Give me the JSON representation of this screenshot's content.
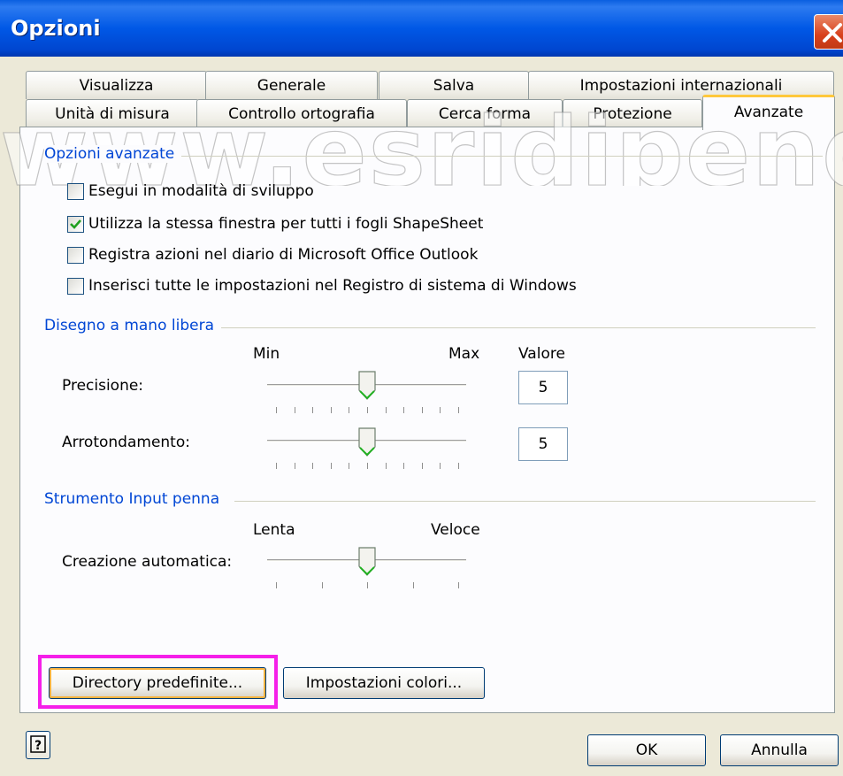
{
  "window": {
    "title": "Opzioni"
  },
  "tabs_row1": [
    "Visualizza",
    "Generale",
    "Salva",
    "Impostazioni internazionali"
  ],
  "tabs_row2": [
    "Unità di misura",
    "Controllo ortografia",
    "Cerca forma",
    "Protezione",
    "Avanzate"
  ],
  "active_tab": "Avanzate",
  "watermark": "www.esridipende",
  "advanced": {
    "title": "Opzioni avanzate",
    "options": [
      {
        "label": "Esegui in modalità di sviluppo",
        "checked": false
      },
      {
        "label": "Utilizza la stessa finestra per tutti i fogli ShapeSheet",
        "checked": true
      },
      {
        "label": "Registra azioni nel diario di Microsoft Office Outlook",
        "checked": false
      },
      {
        "label": "Inserisci tutte le impostazioni nel Registro di sistema di Windows",
        "checked": false
      }
    ]
  },
  "freehand": {
    "title": "Disegno a mano libera",
    "min_label": "Min",
    "max_label": "Max",
    "value_label": "Valore",
    "precision": {
      "label": "Precisione:",
      "value": "5",
      "level": 5,
      "max": 10
    },
    "rounding": {
      "label": "Arrotondamento:",
      "value": "5",
      "level": 5,
      "max": 10
    }
  },
  "pen": {
    "title": "Strumento Input penna",
    "min_label": "Lenta",
    "max_label": "Veloce",
    "auto_create": {
      "label": "Creazione automatica:",
      "level": 2,
      "max": 4
    }
  },
  "buttons": {
    "default_dirs": "Directory predefinite...",
    "color_settings": "Impostazioni colori...",
    "ok": "OK",
    "cancel": "Annulla"
  },
  "colors": {
    "highlight": "#f51fe9",
    "titlebar": "#0058e6",
    "group_title": "#0046d5"
  }
}
